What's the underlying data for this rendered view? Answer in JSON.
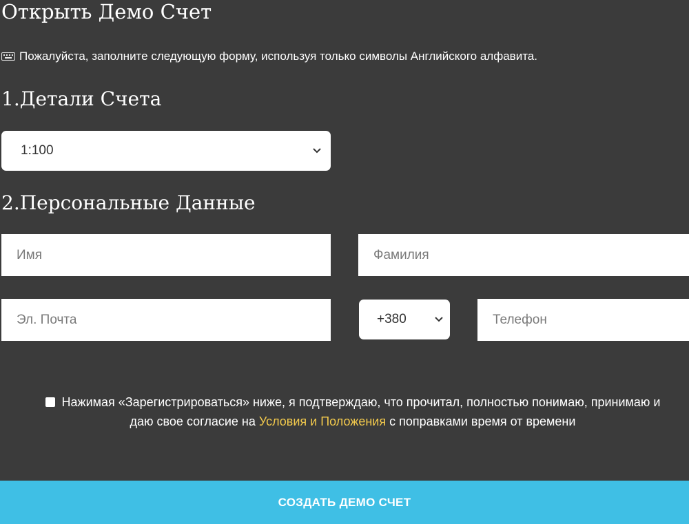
{
  "page": {
    "title": "Открыть Демо Счет",
    "notice": "Пожалуйста, заполните следующую форму, используя только символы Английского алфавита."
  },
  "account_details": {
    "heading": "1.Детали Счета",
    "leverage": {
      "selected": "1:100"
    }
  },
  "personal_data": {
    "heading": "2.Персональные Данные",
    "first_name": {
      "placeholder": "Имя",
      "value": ""
    },
    "last_name": {
      "placeholder": "Фамилия",
      "value": ""
    },
    "email": {
      "placeholder": "Эл. Почта",
      "value": ""
    },
    "phone_code": {
      "selected": "+380"
    },
    "phone": {
      "placeholder": "Телефон",
      "value": ""
    }
  },
  "consent": {
    "checked": false,
    "text_before": "Нажимая «Зарегистрироваться» ниже, я подтверждаю, что прочитал, полностью понимаю, принимаю и даю свое согласие на ",
    "link": "Условия и Положения",
    "text_after": " с поправками время от времени"
  },
  "submit": {
    "label": "СОЗДАТЬ ДЕМО СЧЕТ"
  },
  "colors": {
    "background": "#3b3b3b",
    "button": "#3fbfe5",
    "link": "#f2c94c"
  }
}
